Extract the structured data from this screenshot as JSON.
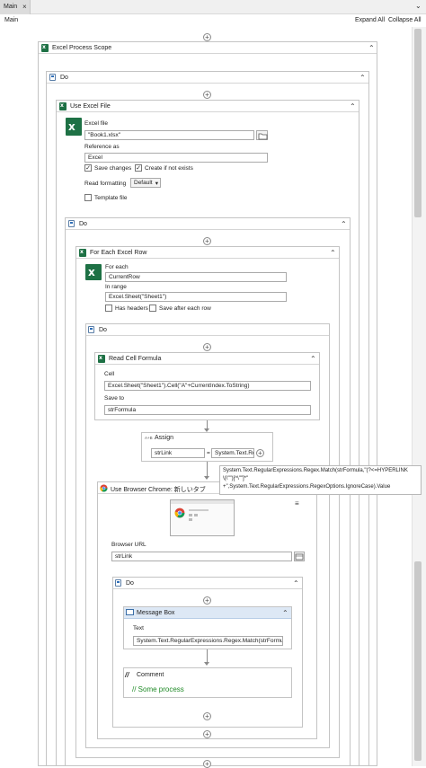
{
  "tab": {
    "label": "Main",
    "close": "×",
    "dropdown": "⌄"
  },
  "breadcrumb": "Main",
  "toolbar": {
    "expand_all": "Expand All",
    "collapse_all": "Collapse All"
  },
  "workflow": {
    "excel_scope": {
      "title": "Excel Process Scope"
    },
    "do_outer": {
      "title": "Do"
    },
    "use_excel": {
      "title": "Use Excel File",
      "file_label": "Excel file",
      "file_value": "\"Book1.xlsx\"",
      "ref_label": "Reference as",
      "ref_value": "Excel",
      "save_changes": "Save changes",
      "create_if_not_exists": "Create if not exists",
      "read_formatting_label": "Read formatting",
      "read_formatting_value": "Default",
      "template_file": "Template file"
    },
    "do_inner": {
      "title": "Do"
    },
    "for_each": {
      "title": "For Each Excel Row",
      "for_each_label": "For each",
      "for_each_value": "CurrentRow",
      "in_range_label": "In range",
      "in_range_value": "Excel.Sheet(\"Sheet1\")",
      "has_headers": "Has headers",
      "save_after_each_row": "Save after each row"
    },
    "do_loop": {
      "title": "Do"
    },
    "read_cell": {
      "title": "Read Cell Formula",
      "cell_label": "Cell",
      "cell_value": "Excel.Sheet(\"Sheet1\").Cell(\"A\"+CurrentIndex.ToString)",
      "save_to_label": "Save to",
      "save_to_value": "strFormula"
    },
    "assign": {
      "title": "Assign",
      "icon_text": "A+B",
      "left_value": "strLink",
      "equals": "=",
      "right_value": "System.Text.Re"
    },
    "tooltip": {
      "line1": "System.Text.RegularExpressions.Regex.Match(strFormula,\"(?<=HYPERLINK",
      "line2": "\\(\\\"\")[^\\\"\"]*\"",
      "line3": "+\",System.Text.RegularExpressions.RegexOptions.IgnoreCase).Value"
    },
    "browser": {
      "title": "Use Browser Chrome: 新しいタブ",
      "url_label": "Browser URL",
      "url_value": "strLink"
    },
    "do_browser": {
      "title": "Do"
    },
    "message_box": {
      "title": "Message Box",
      "text_label": "Text",
      "text_value": "System.Text.RegularExpressions.Regex.Match(strFormu"
    },
    "comment": {
      "title": "Comment",
      "text": "// Some process"
    }
  },
  "icons": {
    "plus": "+",
    "collapse": "⌃",
    "folder": "folder-icon",
    "menu": "≡",
    "dropdown": "▾",
    "check": "✓"
  },
  "colors": {
    "excel_green": "#1e7145",
    "comment_green": "#1f8a27",
    "message_header": "#dde8f5"
  }
}
